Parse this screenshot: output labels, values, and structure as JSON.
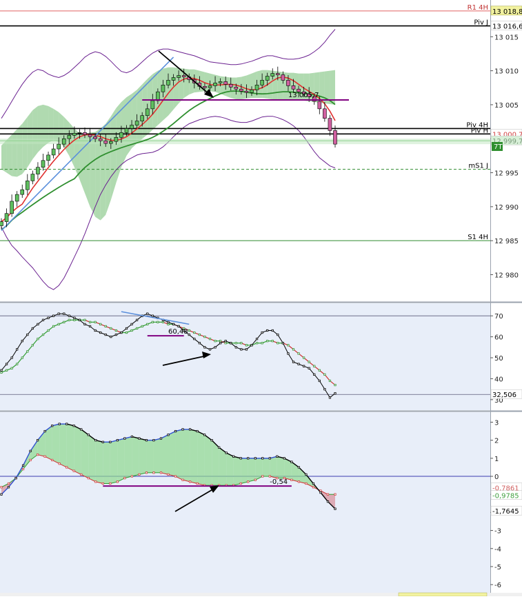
{
  "chart_data": [
    {
      "type": "candlestick",
      "panel": "price",
      "ylim": [
        12976.5,
        13020
      ],
      "y_ticks": [
        "13 015",
        "13 010",
        "13 005",
        "13 000",
        "12 995",
        "12 990",
        "12 985",
        "12 980"
      ],
      "y_tick_values": [
        13015,
        13010,
        13005,
        13000,
        12995,
        12990,
        12985,
        12980
      ],
      "levels": [
        {
          "label": "R1 4H",
          "value": 13018.8,
          "price_label": "13 018,8",
          "color": "#e06060",
          "style": "solid"
        },
        {
          "label": "Piv J",
          "value": 13016.6,
          "price_label": "13 016,6",
          "color": "#000000",
          "style": "solid"
        },
        {
          "label": "Piv 4H",
          "value": 13001.5,
          "price_label": "",
          "color": "#000000",
          "style": "solid"
        },
        {
          "label": "Piv H",
          "value": 13000.7,
          "price_label": "13 000,7",
          "color": "#000000",
          "style": "solid"
        },
        {
          "label": "",
          "value": 12999.7,
          "price_label": "12 999,7",
          "color": "#5bbf5b",
          "style": "solid"
        },
        {
          "label": "mS1 J",
          "value": 12995.5,
          "price_label": "",
          "color": "#2e8b2e",
          "style": "dashed"
        },
        {
          "label": "S1 4H",
          "value": 12985.0,
          "price_label": "",
          "color": "#2e8b2e",
          "style": "solid"
        }
      ],
      "timeframe_badge": "7T",
      "annotations": [
        {
          "text": "13 005,7",
          "value": 13005.7
        }
      ],
      "close": [
        12987.8,
        12989.0,
        12990.8,
        12991.8,
        12992.5,
        12993.8,
        12994.8,
        12995.8,
        12996.8,
        12997.6,
        12998.5,
        12999.2,
        13000.0,
        13000.5,
        13000.8,
        13000.9,
        13000.6,
        13000.3,
        13000.0,
        12999.7,
        12999.3,
        12999.6,
        13000.2,
        13000.9,
        13001.5,
        13002.0,
        13002.6,
        13003.4,
        13004.4,
        13005.6,
        13006.9,
        13007.9,
        13008.6,
        13009.0,
        13009.3,
        13009.1,
        13008.7,
        13008.2,
        13007.7,
        13007.5,
        13007.8,
        13008.2,
        13008.4,
        13008.0,
        13007.6,
        13007.3,
        13007.0,
        13006.8,
        13007.2,
        13007.9,
        13008.6,
        13009.2,
        13009.6,
        13009.4,
        13008.6,
        13007.8,
        13007.3,
        13006.9,
        13006.6,
        13006.2,
        13005.5,
        13004.4,
        13003.0,
        13001.2,
        12999.2
      ],
      "bollinger": {
        "upper": [
          13003.0,
          13004.2,
          13005.5,
          13006.8,
          13008.0,
          13009.0,
          13009.8,
          13010.2,
          13010.0,
          13009.5,
          13009.2,
          13009.0,
          13009.3,
          13009.8,
          13010.5,
          13011.2,
          13012.0,
          13012.5,
          13012.8,
          13012.6,
          13012.1,
          13011.4,
          13010.6,
          13009.9,
          13009.7,
          13010.0,
          13010.6,
          13011.3,
          13012.0,
          13012.6,
          13013.0,
          13013.2,
          13013.2,
          13013.0,
          13012.8,
          13012.6,
          13012.4,
          13012.2,
          13011.9,
          13011.6,
          13011.3,
          13011.2,
          13011.1,
          13011.0,
          13010.9,
          13010.9,
          13011.0,
          13011.2,
          13011.4,
          13011.7,
          13012.0,
          13012.2,
          13012.2,
          13012.0,
          13011.8,
          13011.7,
          13011.7,
          13011.8,
          13012.0,
          13012.3,
          13012.8,
          13013.4,
          13014.2,
          13015.2,
          13016.1
        ],
        "lower": [
          12987.0,
          12985.5,
          12984.3,
          12983.5,
          12982.6,
          12981.8,
          12981.0,
          12980.0,
          12979.0,
          12978.2,
          12977.8,
          12978.4,
          12979.5,
          12981.0,
          12982.6,
          12984.2,
          12986.0,
          12988.0,
          12990.0,
          12991.8,
          12993.2,
          12994.4,
          12995.4,
          12996.2,
          12996.8,
          12997.2,
          12997.6,
          12997.8,
          12997.9,
          12998.0,
          12998.3,
          12998.8,
          12999.5,
          13000.3,
          13001.0,
          13001.7,
          13002.2,
          13002.5,
          13002.8,
          13003.0,
          13003.2,
          13003.3,
          13003.2,
          13003.0,
          13002.7,
          13002.5,
          13002.4,
          13002.4,
          13002.6,
          13002.9,
          13003.2,
          13003.3,
          13003.3,
          13003.1,
          13002.8,
          13002.4,
          13001.9,
          13001.2,
          13000.3,
          12999.2,
          12998.1,
          12997.2,
          12996.6,
          12996.0,
          12995.7
        ]
      },
      "cloud_top": [
        12999.0,
        12999.8,
        13000.6,
        13001.4,
        13002.2,
        13003.2,
        13004.2,
        13004.8,
        13005.0,
        13004.8,
        13004.4,
        13003.9,
        13003.2,
        13002.4,
        13001.5,
        13000.8,
        13000.7,
        13000.9,
        13001.0,
        13001.5,
        13002.2,
        13003.3,
        13004.5,
        13005.4,
        13006.1,
        13006.6,
        13007.2,
        13008.0,
        13008.8,
        13009.5,
        13010.0,
        13010.3,
        13010.5,
        13010.5,
        13010.4,
        13010.3,
        13010.2,
        13010.2,
        13010.0,
        13009.8,
        13009.6,
        13009.4,
        13009.2,
        13009.1,
        13009.0,
        13009.0,
        13009.1,
        13009.3,
        13009.6,
        13009.9,
        13010.1,
        13010.1,
        13010.0,
        13009.9,
        13009.8,
        13009.7,
        13009.7,
        13009.6,
        13009.6,
        13009.6,
        13009.7,
        13009.8,
        13009.9,
        13010.0,
        13010.1
      ],
      "cloud_bottom": [
        12995.5,
        12995.0,
        12994.5,
        12994.4,
        12994.8,
        12995.8,
        12997.0,
        12998.0,
        12998.8,
        12999.4,
        12999.8,
        12999.5,
        12998.8,
        12997.5,
        12995.8,
        12994.0,
        12992.0,
        12990.0,
        12988.5,
        12988.0,
        12988.8,
        12991.0,
        12993.5,
        12995.8,
        12997.5,
        12998.6,
        12999.3,
        13000.0,
        13000.6,
        13001.3,
        13002.0,
        13002.7,
        13003.4,
        13004.3,
        13005.2,
        13006.0,
        13006.5,
        13006.8,
        13006.9,
        13007.0,
        13007.0,
        13006.9,
        13006.6,
        13006.3,
        13006.0,
        13005.8,
        13005.8,
        13005.9,
        13006.0,
        13006.0,
        13006.0,
        13005.9,
        13005.8,
        13005.7,
        13005.6,
        13005.6,
        13005.6,
        13005.6,
        13005.6,
        13005.5,
        13005.4,
        13005.3,
        13005.2,
        13005.1,
        13005.0
      ]
    },
    {
      "type": "line",
      "panel": "oscillator",
      "ylim": [
        26,
        75
      ],
      "y_ticks": [
        "70",
        "60",
        "50",
        "40",
        "30"
      ],
      "y_tick_values": [
        70,
        60,
        50,
        40,
        30
      ],
      "last_value_label": "32,506",
      "last_value": 32.506,
      "annotation": {
        "text": "60,48",
        "value": 60.48
      },
      "levels": [
        70,
        32.5
      ],
      "oscillator": [
        44,
        47,
        50,
        54,
        58,
        61,
        64,
        66,
        68,
        69,
        70,
        71,
        71,
        70,
        69,
        68,
        66,
        65,
        63,
        62,
        61,
        60,
        61,
        62,
        64,
        66,
        68,
        70,
        71,
        70,
        69,
        68,
        67,
        66,
        65,
        63,
        61,
        59,
        57,
        55,
        54,
        55,
        57,
        58,
        57,
        55,
        54,
        54,
        56,
        59,
        62,
        63,
        63,
        61,
        57,
        52,
        48,
        47,
        46,
        45,
        42,
        39,
        35,
        31,
        33
      ],
      "signal": [
        43,
        44,
        45,
        47,
        50,
        53,
        56,
        59,
        61,
        63,
        65,
        66,
        67,
        68,
        68,
        68,
        68,
        67,
        67,
        66,
        65,
        64,
        63,
        62,
        62,
        63,
        64,
        65,
        66,
        67,
        67,
        67,
        66,
        66,
        65,
        64,
        63,
        62,
        61,
        60,
        59,
        58,
        58,
        57,
        57,
        57,
        57,
        56,
        56,
        57,
        57,
        58,
        58,
        57,
        57,
        56,
        54,
        52,
        50,
        48,
        46,
        44,
        42,
        39,
        37
      ]
    },
    {
      "type": "line",
      "panel": "macd",
      "ylim": [
        -6.3,
        3.4
      ],
      "y_ticks": [
        "3",
        "2",
        "1",
        "0",
        "-1",
        "-2",
        "-3",
        "-4",
        "-5",
        "-6"
      ],
      "y_tick_values": [
        3,
        2,
        1,
        0,
        -1,
        -2,
        -3,
        -4,
        -5,
        -6
      ],
      "value_labels": [
        {
          "text": "-0,7861",
          "value": -0.7861,
          "color": "#d06060"
        },
        {
          "text": "-0,9785",
          "value": -0.9785,
          "color": "#40a040"
        },
        {
          "text": "-1,7645",
          "value": -1.7645,
          "color": "#000000"
        }
      ],
      "annotation": {
        "text": "-0,54",
        "value": -0.54
      },
      "macd": [
        -1.0,
        -0.6,
        -0.1,
        0.6,
        1.4,
        2.0,
        2.5,
        2.8,
        2.9,
        2.9,
        2.8,
        2.6,
        2.3,
        2.0,
        1.9,
        1.9,
        2.0,
        2.1,
        2.2,
        2.1,
        2.0,
        2.0,
        2.1,
        2.3,
        2.5,
        2.6,
        2.6,
        2.5,
        2.3,
        2.0,
        1.6,
        1.3,
        1.1,
        1.0,
        1.0,
        1.0,
        1.0,
        1.0,
        1.1,
        1.0,
        0.8,
        0.5,
        0.1,
        -0.4,
        -0.9,
        -1.4,
        -1.8
      ],
      "signal": [
        -0.6,
        -0.4,
        -0.1,
        0.4,
        0.9,
        1.2,
        1.1,
        0.9,
        0.7,
        0.5,
        0.3,
        0.1,
        -0.1,
        -0.3,
        -0.4,
        -0.4,
        -0.3,
        -0.1,
        0.0,
        0.1,
        0.2,
        0.2,
        0.2,
        0.1,
        0.0,
        -0.2,
        -0.3,
        -0.4,
        -0.5,
        -0.5,
        -0.5,
        -0.5,
        -0.5,
        -0.4,
        -0.3,
        -0.2,
        0.0,
        0.0,
        -0.1,
        -0.1,
        -0.2,
        -0.3,
        -0.4,
        -0.6,
        -0.8,
        -1.0,
        -1.0
      ]
    }
  ],
  "colors": {
    "background": "#ffffff",
    "lower_bg": "#e8eef9",
    "bull_cloud": "#8fca8f",
    "bear_cloud": "#c98a98",
    "bollinger": "#6a2090",
    "ma_fast": "#e03030",
    "ma_slow": "#2f8f2f",
    "trend": "#5a8fdc",
    "annotation": "#800080"
  }
}
